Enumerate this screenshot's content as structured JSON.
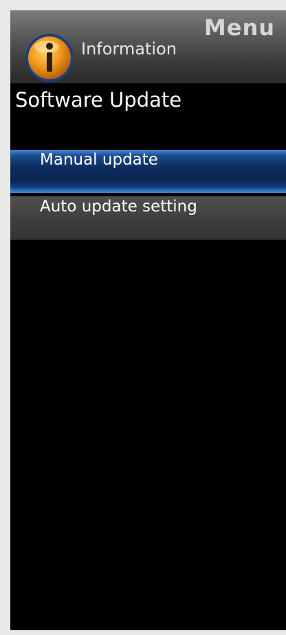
{
  "header": {
    "menu_title": "Menu",
    "category_label": "Information",
    "category_icon": "information-icon"
  },
  "page": {
    "title": "Software Update"
  },
  "menu_items": [
    {
      "label": "Manual update",
      "selected": true
    },
    {
      "label": "Auto update setting",
      "selected": false
    }
  ],
  "colors": {
    "selection_blue": "#0c2d5e",
    "icon_orange": "#f29a1c",
    "background": "#000000"
  }
}
